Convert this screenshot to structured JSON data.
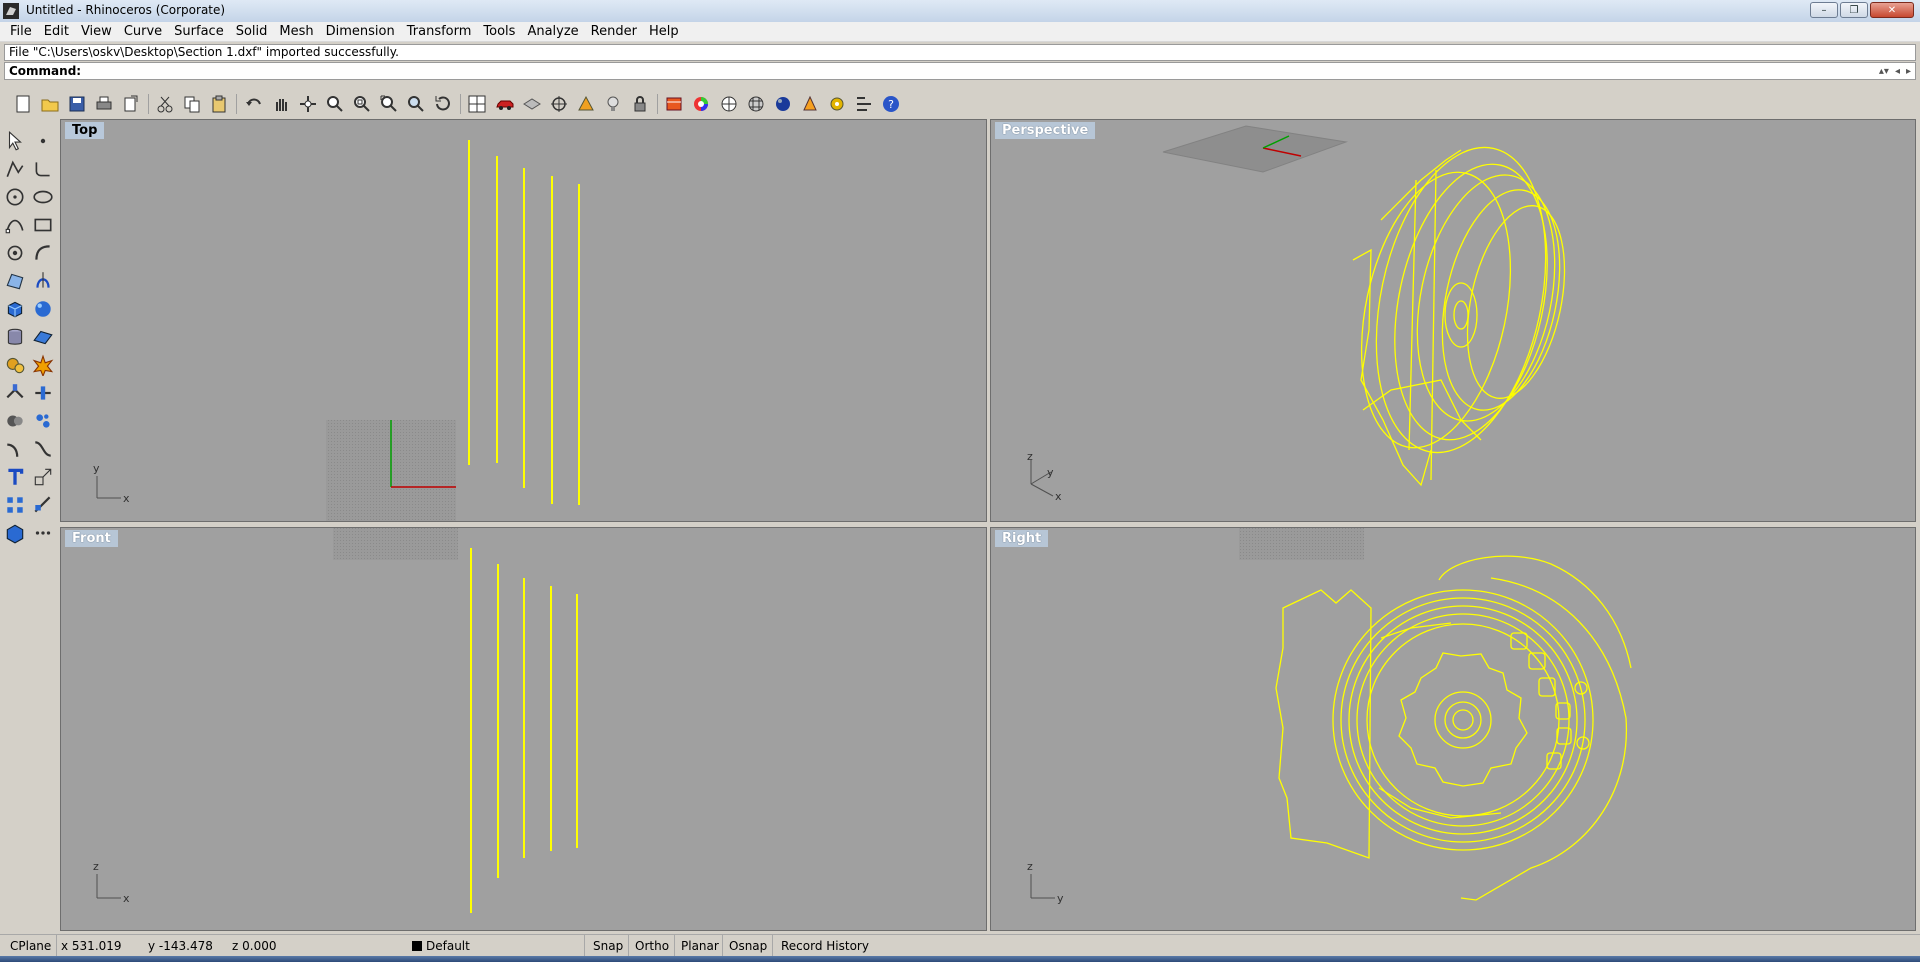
{
  "window": {
    "title": "Untitled - Rhinoceros (Corporate)",
    "minimize": "–",
    "maximize": "❐",
    "close": "✕"
  },
  "menu": [
    "File",
    "Edit",
    "View",
    "Curve",
    "Surface",
    "Solid",
    "Mesh",
    "Dimension",
    "Transform",
    "Tools",
    "Analyze",
    "Render",
    "Help"
  ],
  "history_text": "File \"C:\\Users\\oskv\\Desktop\\Section 1.dxf\" imported successfully.",
  "command_label": "Command:",
  "toolbar_icons": [
    "new-file-icon",
    "open-folder-icon",
    "save-icon",
    "print-icon",
    "export-icon",
    "cut-icon",
    "copy-icon",
    "paste-icon",
    "undo-icon",
    "pan-hand-icon",
    "rotate-view-icon",
    "zoom-icon",
    "zoom-window-icon",
    "zoom-extents-icon",
    "zoom-selected-icon",
    "rotate-icon",
    "four-viewports-icon",
    "car-icon",
    "grid-icon",
    "osnap-icon",
    "cplane-icon",
    "light-bulb-icon",
    "lock-icon",
    "layer-icon",
    "color-wheel-icon",
    "shade-icon",
    "rendered-icon",
    "render-sphere-icon",
    "material-icon",
    "options-gear-icon",
    "properties-icon",
    "help-icon"
  ],
  "left_toolbar": {
    "col1": [
      "select-arrow-icon",
      "polyline-icon",
      "circle-icon",
      "curve-edit-icon",
      "point-edit-icon",
      "surface-icon",
      "box-icon",
      "cylinder-icon",
      "boolean-gear-icon",
      "trim-icon",
      "solid-union-icon",
      "fillet-curve-icon",
      "text-icon",
      "array-icon",
      "box-tools-icon"
    ],
    "col2": [
      "point-icon",
      "fillet-icon",
      "ellipse-icon",
      "rectangle-icon",
      "arc-icon",
      "revolve-icon",
      "sphere-icon",
      "plane-icon",
      "explode-icon",
      "split-icon",
      "group-icon",
      "blend-icon",
      "scale-icon",
      "transform-icon",
      "dots-icon"
    ]
  },
  "viewports": {
    "top": {
      "title": "Top",
      "axis1": "y",
      "axis2": "x"
    },
    "perspective": {
      "title": "Perspective",
      "axis1": "z",
      "axis2": "y",
      "axis3": "x"
    },
    "front": {
      "title": "Front",
      "axis1": "z",
      "axis2": "x"
    },
    "right": {
      "title": "Right",
      "axis1": "z",
      "axis2": "y"
    }
  },
  "status": {
    "cplane": "CPlane",
    "x": "x 531.019",
    "y": "y -143.478",
    "z": "z 0.000",
    "layer": "Default",
    "snap": "Snap",
    "ortho": "Ortho",
    "planar": "Planar",
    "osnap": "Osnap",
    "record_history": "Record History"
  },
  "colors": {
    "viewport_bg": "#a0a0a0",
    "curve": "#ffff00",
    "x_axis": "#c00000",
    "y_axis": "#00a000"
  }
}
